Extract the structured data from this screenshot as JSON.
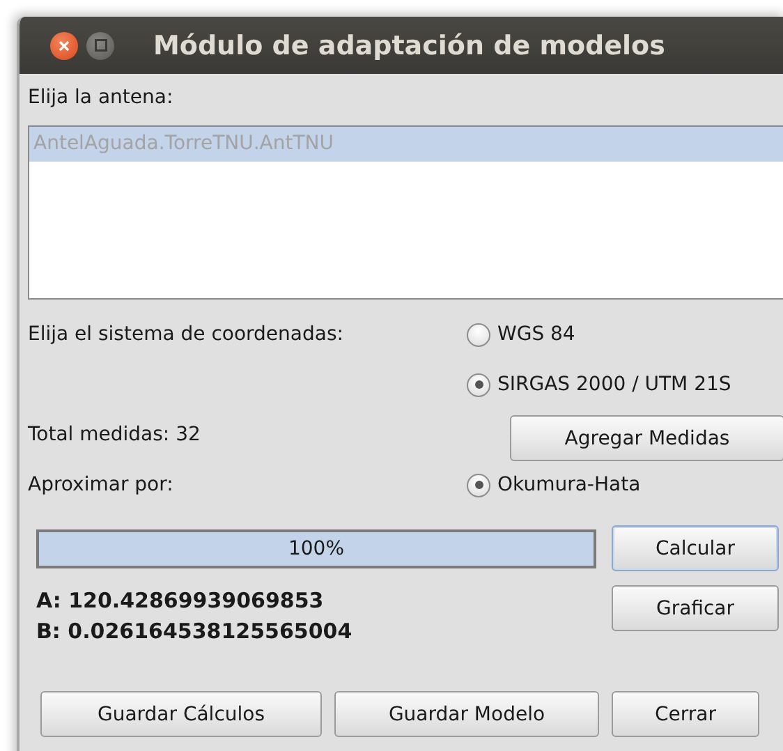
{
  "window": {
    "title": "Módulo de adaptación de modelos"
  },
  "antenna_label": "Elija la antena:",
  "antenna_list": [
    {
      "label": "AntelAguada.TorreTNU.AntTNU",
      "selected": true
    }
  ],
  "coordinate_label": "Elija el sistema de coordenadas:",
  "coordinate_options": [
    {
      "label": "WGS 84",
      "selected": false
    },
    {
      "label": "SIRGAS 2000 / UTM 21S",
      "selected": true
    }
  ],
  "total_label": "Total medidas: 32",
  "add_button": "Agregar Medidas",
  "approx_label": "Aproximar por:",
  "approx_options": [
    {
      "label": "Okumura-Hata",
      "selected": true
    }
  ],
  "progress": {
    "level": 1,
    "text": "100%"
  },
  "calculate_button": {
    "label": "Calcular",
    "focused": true
  },
  "results": [
    "A: 120.42869939069853",
    "B: 0.026164538125565004"
  ],
  "plot_button": {
    "label": "Graficar",
    "focused": false
  },
  "buttons": [
    "Guardar Cálculos",
    "Guardar Modelo",
    "Cerrar"
  ]
}
